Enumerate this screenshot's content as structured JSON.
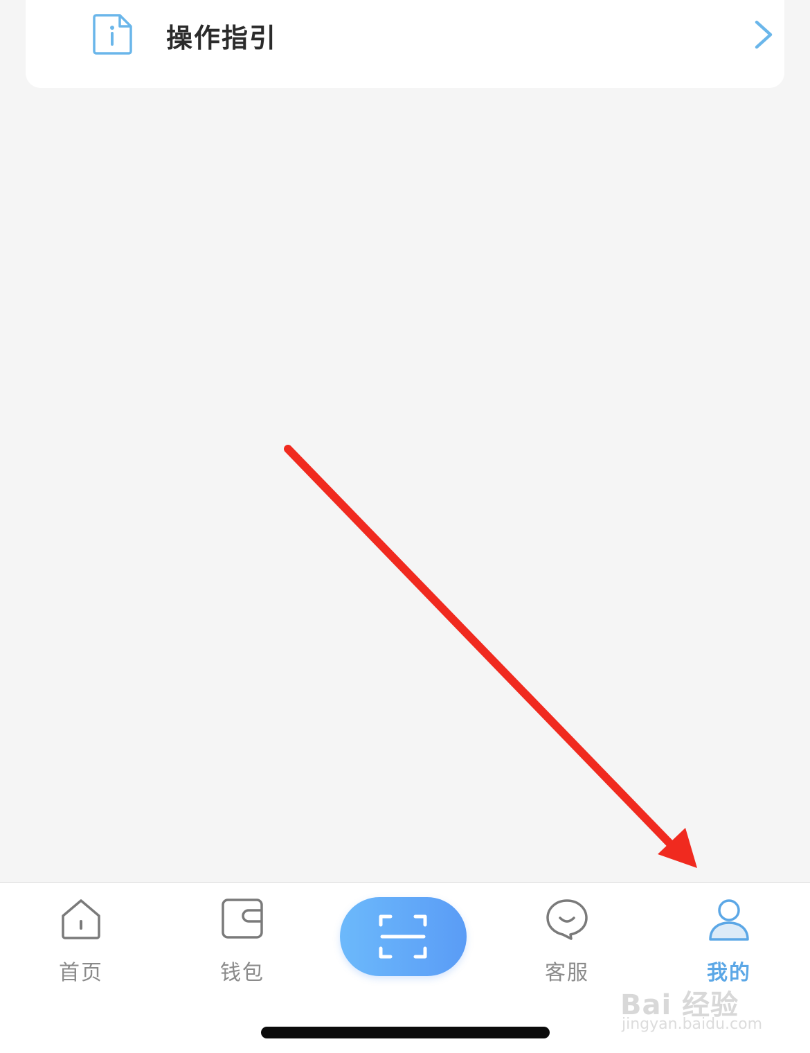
{
  "guide": {
    "label": "操作指引",
    "icon": "info-document-icon",
    "chevron": "chevron-right-icon"
  },
  "tabbar": {
    "active": "我的",
    "items": [
      {
        "label": "首页",
        "icon": "home-icon"
      },
      {
        "label": "钱包",
        "icon": "wallet-icon"
      },
      {
        "label": "客服",
        "icon": "chat-bubble-icon"
      },
      {
        "label": "我的",
        "icon": "user-icon"
      }
    ],
    "center": {
      "icon": "scan-icon"
    }
  },
  "annotation": {
    "icon": "red-arrow-icon",
    "color": "#f02a1f"
  },
  "watermark": {
    "logo": "Bai 经验",
    "url": "jingyan.baidu.com"
  },
  "colors": {
    "accent": "#5ba7e6",
    "background": "#f5f5f5",
    "inactive": "#8a8a8a"
  }
}
